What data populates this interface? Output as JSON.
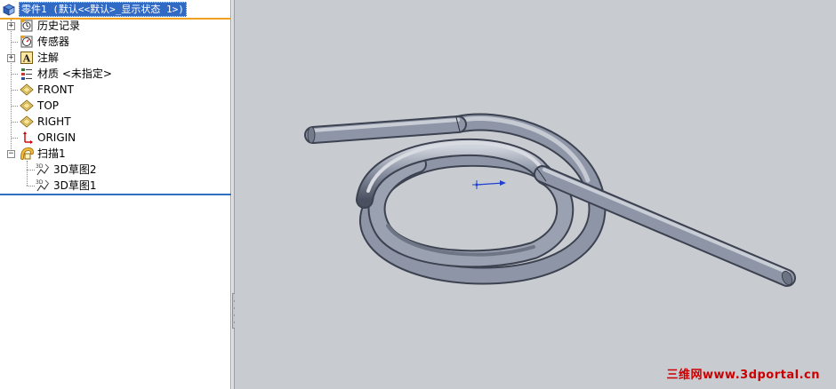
{
  "tree": {
    "root_label": "零件1 (默认<<默认>_显示状态 1>)",
    "items": [
      {
        "label": "历史记录",
        "icon": "history-icon"
      },
      {
        "label": "传感器",
        "icon": "sensor-icon"
      },
      {
        "label": "注解",
        "icon": "annotation-icon"
      },
      {
        "label": "材质 <未指定>",
        "icon": "material-icon"
      },
      {
        "label": "FRONT",
        "icon": "plane-icon"
      },
      {
        "label": "TOP",
        "icon": "plane-icon"
      },
      {
        "label": "RIGHT",
        "icon": "plane-icon"
      },
      {
        "label": "ORIGIN",
        "icon": "origin-icon"
      },
      {
        "label": "扫描1",
        "icon": "sweep-feature-icon"
      },
      {
        "label": "3D草图2",
        "icon": "sketch-3d-icon"
      },
      {
        "label": "3D草图1",
        "icon": "sketch-3d-icon"
      }
    ],
    "expanders": {
      "collapsed": "+",
      "expanded": "−"
    }
  },
  "watermark": "三维网www.3dportal.cn",
  "colors": {
    "selection": "#316ac5",
    "viewport_bg": "#c8cbd0",
    "tube": "#8d95a6",
    "watermark": "#cc0000",
    "origin_arrow": "#1e40d0"
  }
}
